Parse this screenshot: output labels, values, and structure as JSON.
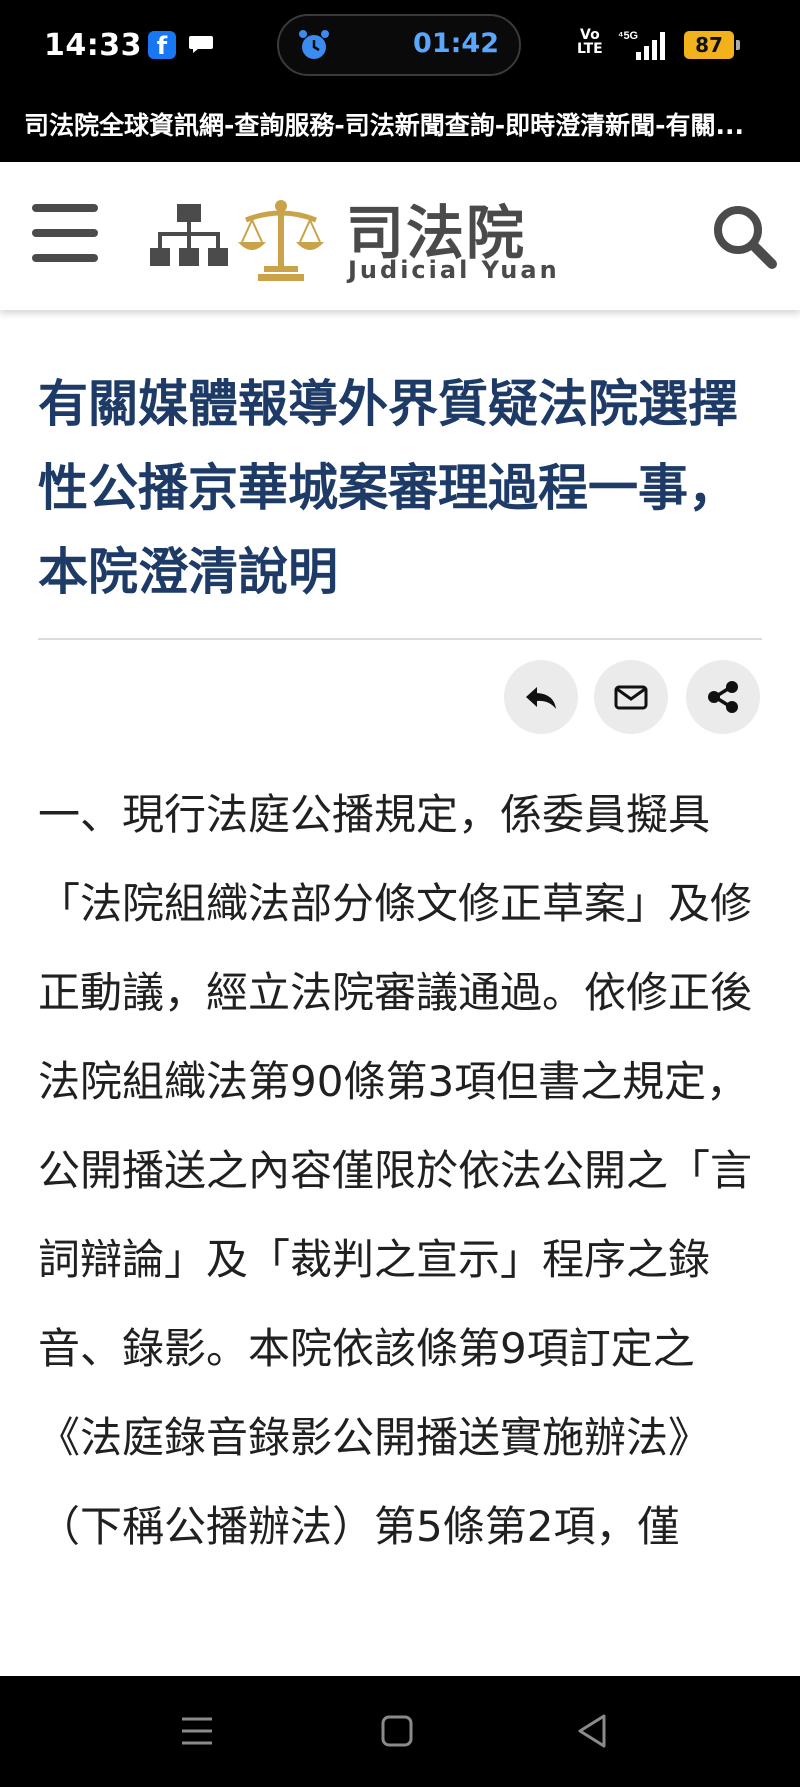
{
  "status_bar": {
    "time": "14:33",
    "fb_icon": "f",
    "timer": "01:42",
    "network_volte": "Vo\nLTE",
    "network_5g": "5G",
    "battery": "87"
  },
  "page_title": "司法院全球資訊網-查詢服務-司法新聞查詢-即時澄清新聞-有關...",
  "header": {
    "logo_cn": "司法院",
    "logo_en": "Judicial Yuan",
    "icons": [
      "menu-icon",
      "sitemap-icon",
      "scales-emblem",
      "search-icon"
    ]
  },
  "article": {
    "title": "有關媒體報導外界質疑法院選擇性公播京華城案審理過程一事，本院澄清說明",
    "actions": [
      "back-icon",
      "mail-icon",
      "share-icon"
    ],
    "body": "一、現行法庭公播規定，係委員擬具「法院組織法部分條文修正草案」及修正動議，經立法院審議通過。依修正後法院組織法第90條第3項但書之規定，公開播送之內容僅限於依法公開之「言詞辯論」及「裁判之宣示」程序之錄音、錄影。本院依該條第9項訂定之《法庭錄音錄影公開播送實施辦法》（下稱公播辦法）第5條第2項，僅"
  },
  "nav": {
    "icons": [
      "recent-apps-icon",
      "home-icon",
      "back-nav-icon"
    ]
  },
  "colors": {
    "title_blue": "#1d3b66",
    "emblem_gold": "#c9a24a",
    "battery": "#f1b21c",
    "timer_blue": "#5aa7ff"
  }
}
